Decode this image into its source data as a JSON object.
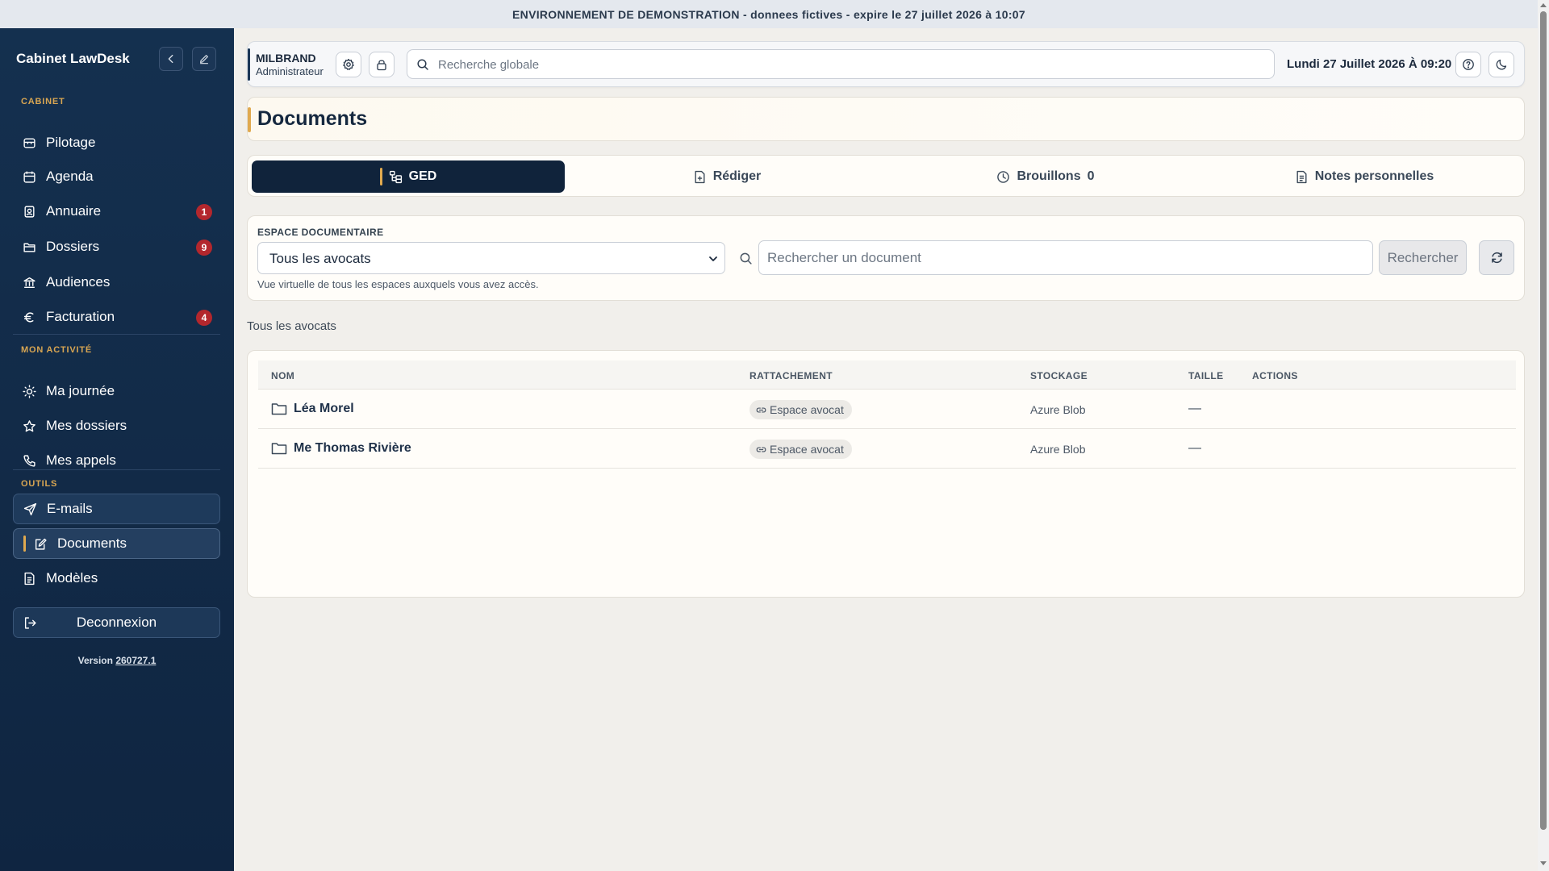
{
  "banner": "ENVIRONNEMENT DE DEMONSTRATION - donnees fictives - expire le 27 juillet 2026 à 10:07",
  "sidebar": {
    "brand": "Cabinet LawDesk",
    "sections": {
      "cabinet": "CABINET",
      "activity": "MON ACTIVITÉ",
      "tools": "OUTILS"
    },
    "items": [
      {
        "label": "Pilotage",
        "icon": "dashboard-icon"
      },
      {
        "label": "Agenda",
        "icon": "calendar-icon"
      },
      {
        "label": "Annuaire",
        "icon": "contacts-icon",
        "badge": "1"
      },
      {
        "label": "Dossiers",
        "icon": "folder-icon",
        "badge": "9"
      },
      {
        "label": "Audiences",
        "icon": "courthouse-icon"
      },
      {
        "label": "Facturation",
        "icon": "euro-icon",
        "badge": "4"
      },
      {
        "label": "Ma journée",
        "icon": "sun-icon"
      },
      {
        "label": "Mes dossiers",
        "icon": "star-icon"
      },
      {
        "label": "Mes appels",
        "icon": "phone-icon"
      },
      {
        "label": "E-mails",
        "icon": "send-icon"
      },
      {
        "label": "Documents",
        "icon": "document-edit-icon",
        "active": true
      },
      {
        "label": "Modèles",
        "icon": "template-icon"
      }
    ],
    "logout": "Deconnexion",
    "version_label": "Version",
    "version_number": "260727.1"
  },
  "topbar": {
    "user_name": "MILBRAND",
    "user_role": "Administrateur",
    "search_placeholder": "Recherche globale",
    "datetime": "Lundi 27 Juillet 2026 À 09:20"
  },
  "page": {
    "title": "Documents"
  },
  "tabs": [
    {
      "label": "GED",
      "icon": "tree-icon",
      "active": true
    },
    {
      "label": "Rédiger",
      "icon": "file-plus-icon"
    },
    {
      "label": "Brouillons",
      "icon": "clock-icon",
      "count": "0"
    },
    {
      "label": "Notes personnelles",
      "icon": "note-icon"
    }
  ],
  "doc_space": {
    "label": "ESPACE DOCUMENTAIRE",
    "selected": "Tous les avocats",
    "hint": "Vue virtuelle de tous les espaces auxquels vous avez accès.",
    "search_placeholder": "Rechercher un document",
    "search_button": "Rechercher"
  },
  "breadcrumb": "Tous les avocats",
  "table": {
    "columns": [
      "NOM",
      "RATTACHEMENT",
      "STOCKAGE",
      "TAILLE",
      "ACTIONS"
    ],
    "rows": [
      {
        "name": "Léa Morel",
        "attachment": "Espace avocat",
        "storage": "Azure Blob",
        "size": "—"
      },
      {
        "name": "Me Thomas Rivière",
        "attachment": "Espace avocat",
        "storage": "Azure Blob",
        "size": "—"
      }
    ]
  },
  "colors": {
    "sidebar_bg": "#14304f",
    "accent": "#e0a94f",
    "badge": "#b3272d",
    "active_tab": "#10233b"
  }
}
